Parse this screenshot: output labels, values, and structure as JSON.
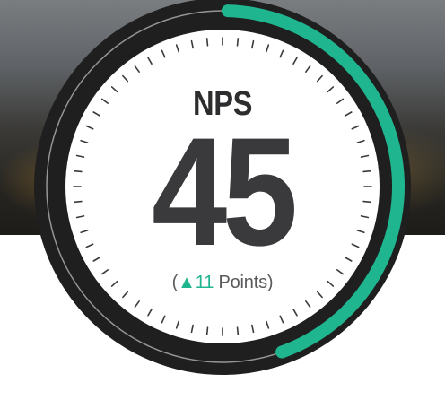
{
  "gauge": {
    "title": "NPS",
    "value": "45",
    "change": {
      "open_paren": "(",
      "arrow": "▲",
      "amount": "11",
      "unit": " Points)"
    },
    "progress_fraction": 0.45,
    "colors": {
      "progress": "#1fb58f",
      "dial_face": "#ffffff",
      "ring_dark": "#1f1f1f",
      "tick": "#3a3a3a",
      "text": "#3a3a3c"
    },
    "tick_count": 60
  }
}
